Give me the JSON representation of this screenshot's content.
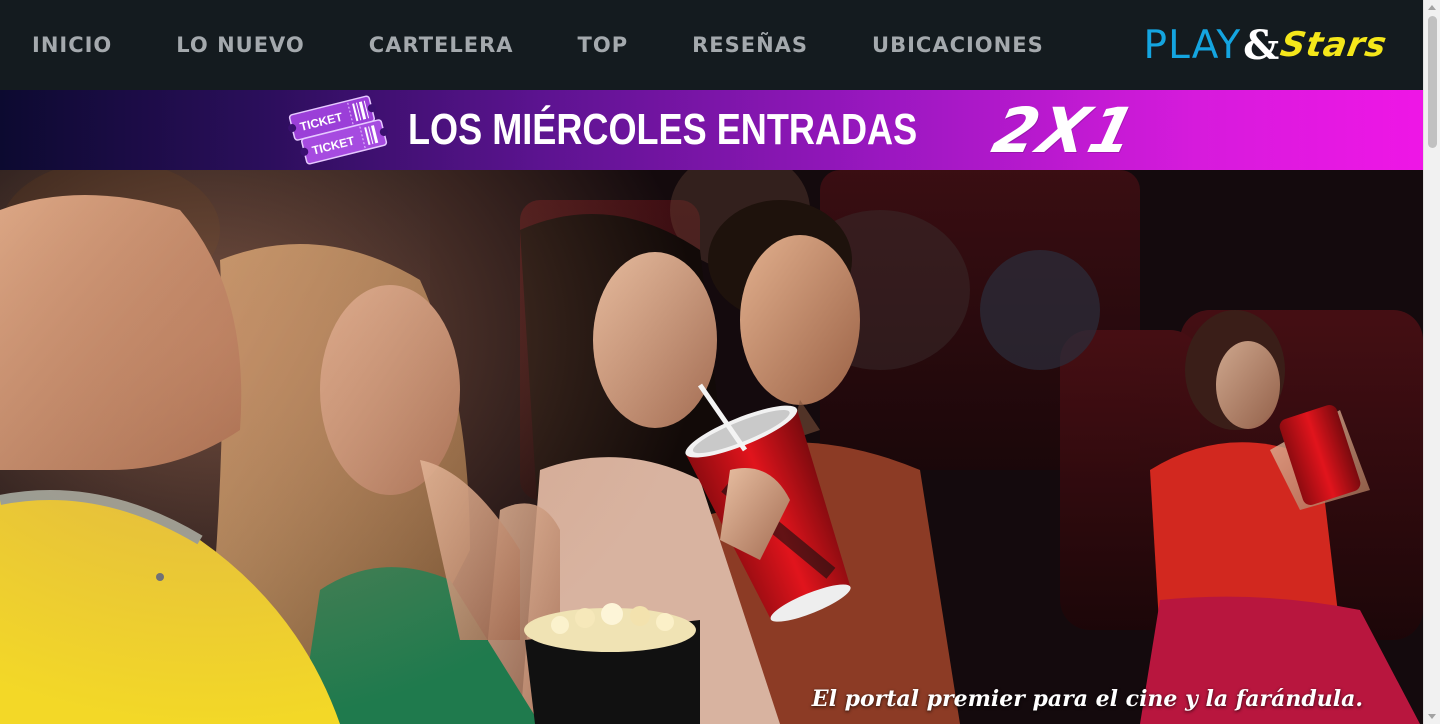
{
  "nav": {
    "items": [
      {
        "label": "INICIO"
      },
      {
        "label": "LO NUEVO"
      },
      {
        "label": "CARTELERA"
      },
      {
        "label": "TOP"
      },
      {
        "label": "RESEÑAS"
      },
      {
        "label": "UBICACIONES"
      }
    ]
  },
  "logo": {
    "play": "PLAY",
    "amp": "&",
    "stars": "Stars",
    "colors": {
      "play": "#14a5e0",
      "amp": "#ffffff",
      "stars": "#f5e71a"
    }
  },
  "promo": {
    "ticket_text_top": "TICKET",
    "ticket_text_bottom": "TICKET",
    "text": "LOS MIÉRCOLES ENTRADAS",
    "highlight": "2X1",
    "gradient": [
      "#0c0a30",
      "#5c1390",
      "#ef16e6"
    ]
  },
  "hero": {
    "image": "cinema-audience-photo",
    "tagline": "El portal premier para el cine y la farándula."
  },
  "icons": {
    "ticket": "ticket-icon",
    "scroll_up": "chevron-up-icon",
    "scroll_down": "chevron-down-icon"
  }
}
